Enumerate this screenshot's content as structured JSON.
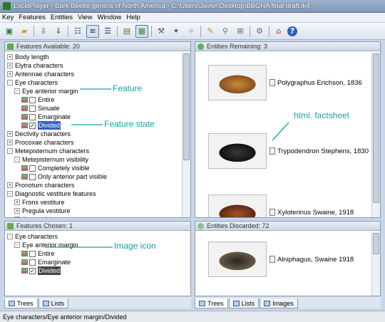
{
  "window": {
    "title": "LucidPlayer - Bark Beetle genera of North America - C:\\Users\\Javier\\Desktop\\BBGNA final draft.lk4"
  },
  "menu": [
    "Key",
    "Features",
    "Entities",
    "View",
    "Window",
    "Help"
  ],
  "toolbar_icons": [
    "new-key-icon",
    "open-folder-icon",
    "sep",
    "load-icon",
    "save-icon",
    "sep",
    "tree-view-icon",
    "list-view-icon",
    "grouped-view-icon",
    "sep",
    "show-images-icon",
    "show-image-icon-active",
    "sep",
    "hammer-icon",
    "magic-wand-icon",
    "wand-alt-icon",
    "sep",
    "pin-icon",
    "find-icon",
    "subset-icon",
    "sep",
    "settings-icon",
    "sep",
    "home-icon",
    "help-icon"
  ],
  "features_available": {
    "header": "Features Available: 20",
    "items": [
      {
        "text": "Body length",
        "level": 0,
        "exp": "+"
      },
      {
        "text": "Elytra characters",
        "level": 0,
        "exp": "+"
      },
      {
        "text": "Antennae characters",
        "level": 0,
        "exp": "+"
      },
      {
        "text": "Eye characters",
        "level": 0,
        "exp": "-"
      },
      {
        "text": "Eye anterior margin",
        "level": 1,
        "exp": "-"
      },
      {
        "text": "Entire",
        "level": 2,
        "state": true
      },
      {
        "text": "Sinuate",
        "level": 2,
        "state": true
      },
      {
        "text": "Emarginate",
        "level": 2,
        "state": true
      },
      {
        "text": "Divided",
        "level": 2,
        "state": true,
        "checked": true,
        "selected": true
      },
      {
        "text": "Declivity characters",
        "level": 0,
        "exp": "+"
      },
      {
        "text": "Procoxae characters",
        "level": 0,
        "exp": "+"
      },
      {
        "text": "Metepisternum characters",
        "level": 0,
        "exp": "-"
      },
      {
        "text": "Metepisternum visibility",
        "level": 1,
        "exp": "-"
      },
      {
        "text": "Completely visible",
        "level": 2,
        "state": true
      },
      {
        "text": "Only anterior part visible",
        "level": 2,
        "state": true
      },
      {
        "text": "Pronotum characters",
        "level": 0,
        "exp": "+"
      },
      {
        "text": "Diagnostic vestiture features",
        "level": 0,
        "exp": "-"
      },
      {
        "text": "Frons vestiture",
        "level": 1,
        "exp": "+"
      },
      {
        "text": "Pregula vestiture",
        "level": 1,
        "exp": "+"
      },
      {
        "text": "Antennal long setae",
        "level": 1,
        "exp": "+"
      }
    ]
  },
  "features_chosen": {
    "header": "Features Chosen: 1",
    "items": [
      {
        "text": "Eye characters",
        "level": 0,
        "exp": "-"
      },
      {
        "text": "Eye anterior margin",
        "level": 1,
        "exp": "-"
      },
      {
        "text": "Entire",
        "level": 2,
        "state": true
      },
      {
        "text": "Emarginate",
        "level": 2,
        "state": true
      },
      {
        "text": "Divided",
        "level": 2,
        "state": true,
        "checked": true,
        "selected": true
      }
    ]
  },
  "entities_remaining": {
    "header": "Entities Remaining: 3",
    "items": [
      {
        "label": "Polygraphus Erichson, 1836",
        "photo_colors": [
          "#c88a3a",
          "#8a5020"
        ]
      },
      {
        "label": "Trypodendron Stephens, 1830",
        "photo_colors": [
          "#3a3a3a",
          "#111"
        ]
      },
      {
        "label": "Xyloterinus Swaine, 1918",
        "photo_colors": [
          "#a0522d",
          "#5a2a12"
        ]
      }
    ]
  },
  "entities_discarded": {
    "header": "Entities Discarded: 72",
    "items": [
      {
        "label": "Alniphagus, Swaine 1918",
        "photo_colors": [
          "#2a2520",
          "#6a5a48"
        ]
      }
    ]
  },
  "annotations": {
    "feature": "Feature",
    "feature_state": "Feature state",
    "factsheet": "html. factsheet",
    "image_icon": "Image icon"
  },
  "left_tabs": [
    "Trees",
    "Lists"
  ],
  "right_tabs": [
    "Trees",
    "Lists",
    "Images"
  ],
  "status": "Eye characters/Eye anterior margin/Divided",
  "colors": {
    "annotation": "#16a0a8",
    "selection": "#3161c6"
  }
}
